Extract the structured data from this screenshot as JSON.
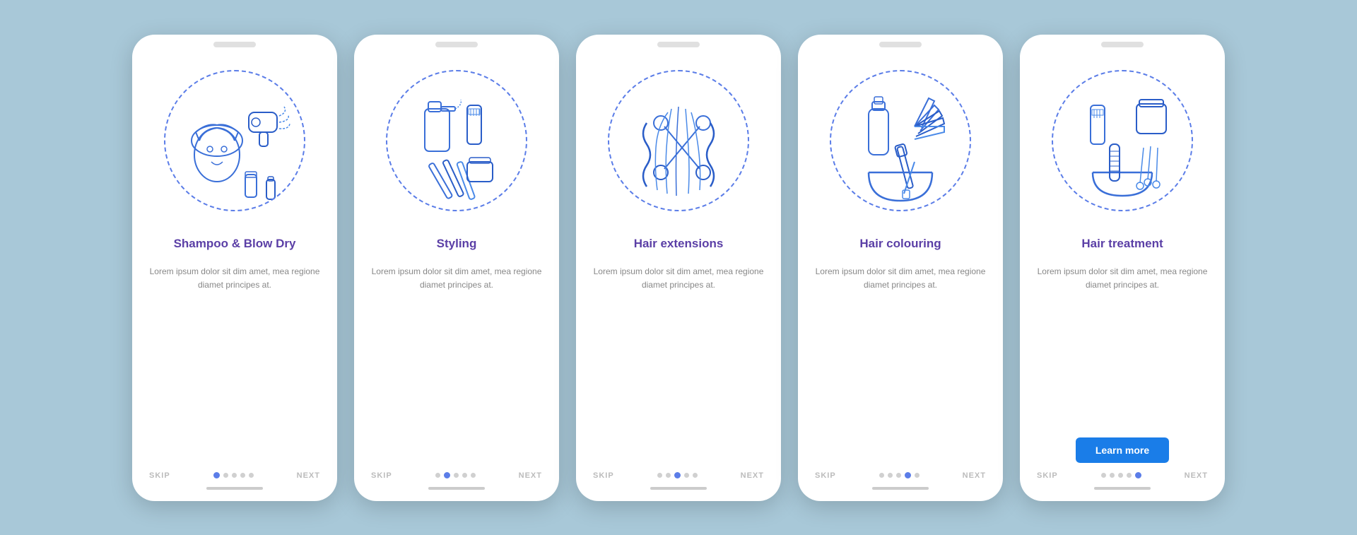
{
  "background_color": "#a8c8d8",
  "phones": [
    {
      "id": "shampoo",
      "title": "Shampoo & Blow Dry",
      "description": "Lorem ipsum dolor sit dim amet, mea regione diamet principes at.",
      "active_dot": 0,
      "total_dots": 5,
      "has_learn_more": false,
      "skip_label": "SKIP",
      "next_label": "NEXT"
    },
    {
      "id": "styling",
      "title": "Styling",
      "description": "Lorem ipsum dolor sit dim amet, mea regione diamet principes at.",
      "active_dot": 1,
      "total_dots": 5,
      "has_learn_more": false,
      "skip_label": "SKIP",
      "next_label": "NEXT"
    },
    {
      "id": "hair-extensions",
      "title": "Hair extensions",
      "description": "Lorem ipsum dolor sit dim amet, mea regione diamet principes at.",
      "active_dot": 2,
      "total_dots": 5,
      "has_learn_more": false,
      "skip_label": "SKIP",
      "next_label": "NEXT"
    },
    {
      "id": "hair-colouring",
      "title": "Hair colouring",
      "description": "Lorem ipsum dolor sit dim amet, mea regione diamet principes at.",
      "active_dot": 3,
      "total_dots": 5,
      "has_learn_more": false,
      "skip_label": "SKIP",
      "next_label": "NEXT"
    },
    {
      "id": "hair-treatment",
      "title": "Hair treatment",
      "description": "Lorem ipsum dolor sit dim amet, mea regione diamet principes at.",
      "active_dot": 4,
      "total_dots": 5,
      "has_learn_more": true,
      "learn_more_label": "Learn more",
      "skip_label": "SKIP",
      "next_label": "NEXT"
    }
  ]
}
